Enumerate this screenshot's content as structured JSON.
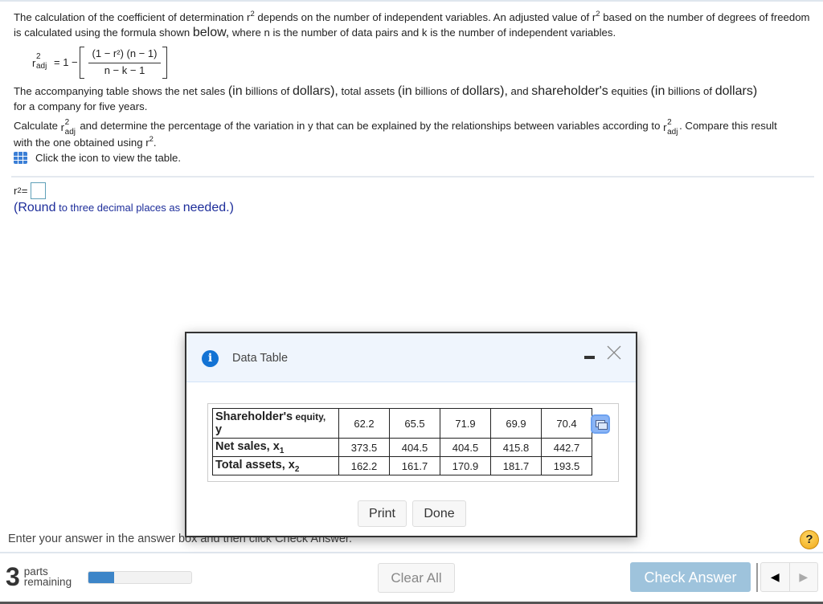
{
  "question": {
    "p1_a": "The calculation of the coefficient of determination r",
    "p1_b": " depends on the number of independent variables. An adjusted value of r",
    "p1_c": " based on the number of degrees of freedom is calculated using the formula shown ",
    "p1_below": "below,",
    "p1_d": "  where n is the number of data pairs and k is the number of independent variables.",
    "sup2": "2",
    "formula": {
      "lhs_r": "r",
      "lhs_sup": "2",
      "lhs_sub": "adj",
      "eq": "= 1 −",
      "numerator": "(1 − r²) (n − 1)",
      "denominator": "n − k − 1"
    },
    "p2": [
      {
        "t": "The accompanying table shows the net sales ",
        "big": false
      },
      {
        "t": "(in",
        "big": true
      },
      {
        "t": " billions of ",
        "big": false
      },
      {
        "t": "dollars),",
        "big": true
      },
      {
        "t": "  total assets ",
        "big": false
      },
      {
        "t": "(in",
        "big": true
      },
      {
        "t": " billions of ",
        "big": false
      },
      {
        "t": "dollars),",
        "big": true
      },
      {
        "t": "  and ",
        "big": false
      },
      {
        "t": "shareholder's",
        "big": true
      },
      {
        "t": "   equities ",
        "big": false
      },
      {
        "t": "(in",
        "big": true
      },
      {
        "t": " billions of ",
        "big": false
      },
      {
        "t": "dollars)",
        "big": true
      }
    ],
    "p2_end": "for a company for five years.",
    "p3_a": "Calculate ",
    "p3_b": " and determine the percentage of the variation in y that can be explained by the relationships between variables according to ",
    "p3_c": ". Compare this result",
    "p3_d": "with the one obtained using r",
    "p3_e": ".",
    "table_link": "Click the icon to view the table."
  },
  "answer": {
    "label": "r",
    "label_sup": "2",
    "equals": " =",
    "value": "",
    "hint_open": "(Round",
    "hint_mid": "  to three decimal places as ",
    "hint_end": "needed.)"
  },
  "modal": {
    "title": "Data Table",
    "rows": [
      {
        "label": "Shareholder's",
        "label_small": " equity,",
        "label_line2": "y",
        "sub": "",
        "values": [
          "62.2",
          "65.5",
          "71.9",
          "69.9",
          "70.4"
        ]
      },
      {
        "label": "Net sales, x",
        "sub": "1",
        "values": [
          "373.5",
          "404.5",
          "404.5",
          "415.8",
          "442.7"
        ]
      },
      {
        "label": "Total assets, x",
        "sub": "2",
        "values": [
          "162.2",
          "161.7",
          "170.9",
          "181.7",
          "193.5"
        ]
      }
    ],
    "print_label": "Print",
    "done_label": "Done"
  },
  "footer": {
    "instruction": "Enter your answer in the answer box and then click Check Answer.",
    "help": "?",
    "parts_count": "3",
    "parts_label_1": "parts",
    "parts_label_2": "remaining",
    "progress_fraction": 0.25,
    "clear_all": "Clear All",
    "check_answer": "Check Answer",
    "prev": "◀",
    "next": "▶",
    "colors": {
      "progress": "#3d85c8",
      "check_answer_bg": "#9ec3dc",
      "accent": "#1373d4"
    }
  }
}
